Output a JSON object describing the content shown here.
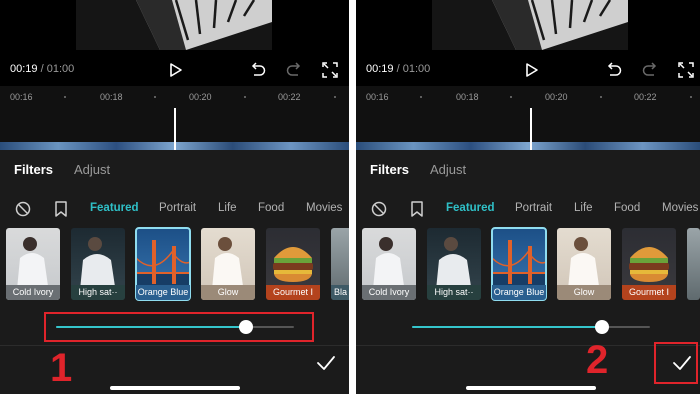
{
  "colors": {
    "accent": "#2fc0c7",
    "highlight": "#e0242b"
  },
  "player": {
    "current_time": "00:19",
    "separator": " / ",
    "total_time": "01:00"
  },
  "timeline": {
    "ticks": [
      "00:16",
      "00:18",
      "00:20",
      "00:22"
    ]
  },
  "tabs": {
    "filters": "Filters",
    "adjust": "Adjust"
  },
  "categories": {
    "featured": "Featured",
    "portrait": "Portrait",
    "life": "Life",
    "food": "Food",
    "movies": "Movies"
  },
  "filters": [
    {
      "label": "Cold Ivory"
    },
    {
      "label": "High sat··"
    },
    {
      "label": "Orange Blue"
    },
    {
      "label": "Glow"
    },
    {
      "label": "Gourmet I"
    },
    {
      "label": "Bla"
    }
  ],
  "intensity": {
    "left_fraction": 0.8,
    "right_fraction": 0.8
  },
  "steps": {
    "one": "1",
    "two": "2"
  },
  "icons": [
    "play-icon",
    "undo-icon",
    "redo-icon",
    "fullscreen-icon",
    "none-icon",
    "bookmark-icon",
    "checkmark-icon"
  ]
}
